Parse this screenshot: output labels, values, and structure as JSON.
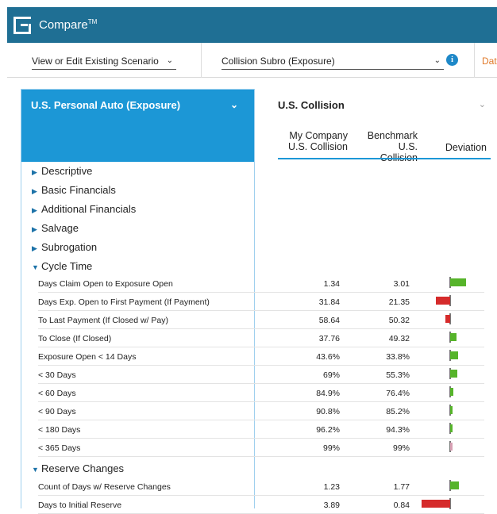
{
  "app": {
    "title": "Compare",
    "trademark": "TM"
  },
  "selectors": {
    "scenario": "View or Edit Existing Scenario",
    "report": "Collision Subro (Exposure)",
    "data_link": "Data"
  },
  "left_panel": {
    "title": "U.S. Personal Auto (Exposure)"
  },
  "right_panel": {
    "title": "U.S. Collision",
    "col1": "My Company U.S. Collision",
    "col1_a": "My Company",
    "col1_b": "U.S. Collision",
    "col2_a": "Benchmark U.S.",
    "col2_b": "Collision",
    "col3": "Deviation"
  },
  "categories": {
    "descriptive": "Descriptive",
    "basic_financials": "Basic Financials",
    "additional_financials": "Additional Financials",
    "salvage": "Salvage",
    "subrogation": "Subrogation",
    "cycle_time": "Cycle Time",
    "reserve_changes": "Reserve Changes"
  },
  "cycle_rows": [
    {
      "label": "Days Claim Open to Exposure Open",
      "my": "1.34",
      "bench": "3.01",
      "deviation": 0.55,
      "color": "#56b42a"
    },
    {
      "label": "Days Exp. Open to First Payment (If Payment)",
      "my": "31.84",
      "bench": "21.35",
      "deviation": -0.49,
      "color": "#d52b2b"
    },
    {
      "label": "To Last Payment (If Closed w/ Pay)",
      "my": "58.64",
      "bench": "50.32",
      "deviation": -0.17,
      "color": "#d52b2b"
    },
    {
      "label": "To Close (If Closed)",
      "my": "37.76",
      "bench": "49.32",
      "deviation": 0.23,
      "color": "#56b42a"
    },
    {
      "label": "Exposure Open < 14 Days",
      "my": "43.6%",
      "bench": "33.8%",
      "deviation": 0.29,
      "color": "#56b42a"
    },
    {
      "label": "< 30 Days",
      "my": "69%",
      "bench": "55.3%",
      "deviation": 0.25,
      "color": "#56b42a"
    },
    {
      "label": "< 60 Days",
      "my": "84.9%",
      "bench": "76.4%",
      "deviation": 0.11,
      "color": "#56b42a"
    },
    {
      "label": "< 90 Days",
      "my": "90.8%",
      "bench": "85.2%",
      "deviation": 0.07,
      "color": "#56b42a"
    },
    {
      "label": "< 180 Days",
      "my": "96.2%",
      "bench": "94.3%",
      "deviation": 0.02,
      "color": "#56b42a"
    },
    {
      "label": "< 365 Days",
      "my": "99%",
      "bench": "99%",
      "deviation": 0.0,
      "color": "#d8a0b4"
    }
  ],
  "reserve_rows": [
    {
      "label": "Count of Days w/ Reserve Changes",
      "my": "1.23",
      "bench": "1.77",
      "deviation": 0.3,
      "color": "#56b42a"
    },
    {
      "label": "Days to Initial Reserve",
      "my": "3.89",
      "bench": "0.84",
      "deviation": -3.6,
      "color": "#d52b2b"
    }
  ]
}
